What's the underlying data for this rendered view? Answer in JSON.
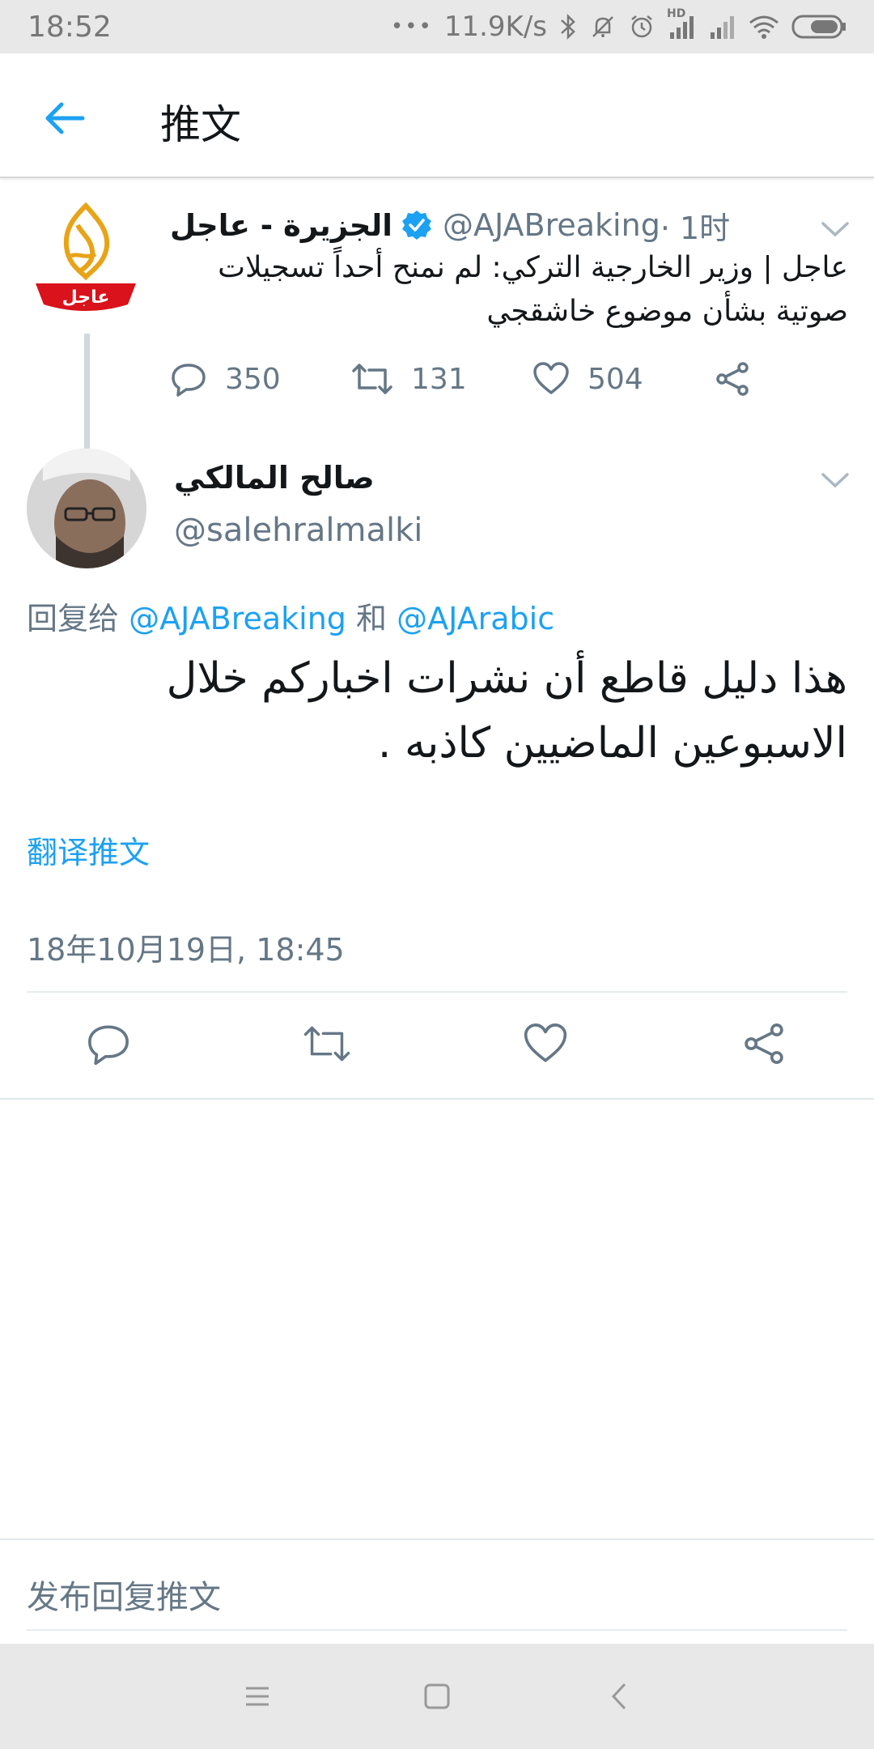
{
  "status_bar": {
    "time": "18:52",
    "dots": "•••",
    "speed": "11.9K/s",
    "hd_label": "HD",
    "icons": [
      "bluetooth-icon",
      "mute-icon",
      "alarm-icon",
      "signal-icon",
      "signal-icon",
      "wifi-icon",
      "battery-icon"
    ]
  },
  "header": {
    "back_icon": "arrow-left-icon",
    "title": "推文"
  },
  "parent_tweet": {
    "author_name": "الجزيرة - عاجل",
    "verified": true,
    "handle": "@AJABreaking",
    "time": " · 1时",
    "text": "عاجل | وزير الخارجية التركي: لم نمنح أحداً تسجيلات صوتية بشأن موضوع خاشقجي",
    "logo_text": "عاجل",
    "replies": "350",
    "retweets": "131",
    "likes": "504"
  },
  "main_tweet": {
    "author_name": "صالح المالكي",
    "handle": "@salehralmalki",
    "reply_prefix": "回复给 ",
    "reply_to_1": "@AJABreaking",
    "reply_join": " 和 ",
    "reply_to_2": "@AJArabic",
    "text": "هذا دليل قاطع أن نشرات اخباركم خلال الاسبوعين الماضيين كاذبه .",
    "translate": "翻译推文",
    "timestamp": "18年10月19日, 18:45"
  },
  "reply_input": {
    "placeholder": "发布回复推文"
  },
  "colors": {
    "accent": "#1da1f2",
    "secondary_text": "#657786",
    "aj_red": "#d9121b",
    "aj_gold": "#e8a317"
  }
}
